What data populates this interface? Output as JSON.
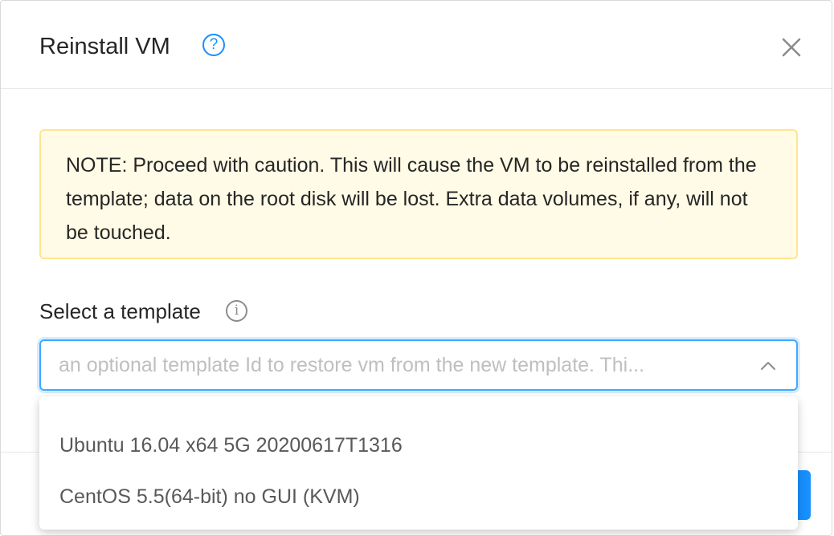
{
  "dialog": {
    "title": "Reinstall VM",
    "help_icon_glyph": "?",
    "close_icon": "close-icon"
  },
  "alert": {
    "text": "NOTE: Proceed with caution. This will cause the VM to be reinstalled from the template; data on the root disk will be lost. Extra data volumes, if any, will not be touched.",
    "background": "#fffbe6",
    "border": "#ffe58f"
  },
  "template_field": {
    "label": "Select a template",
    "info_icon_glyph": "i",
    "placeholder": "an optional template Id to restore vm from the new template. Thi...",
    "options": [
      "Ubuntu 16.04 x64 5G 20200617T1316",
      "CentOS 5.5(64-bit) no GUI (KVM)"
    ]
  },
  "colors": {
    "accent": "#1890ff",
    "text": "#262626",
    "placeholder": "#bfbfbf"
  }
}
